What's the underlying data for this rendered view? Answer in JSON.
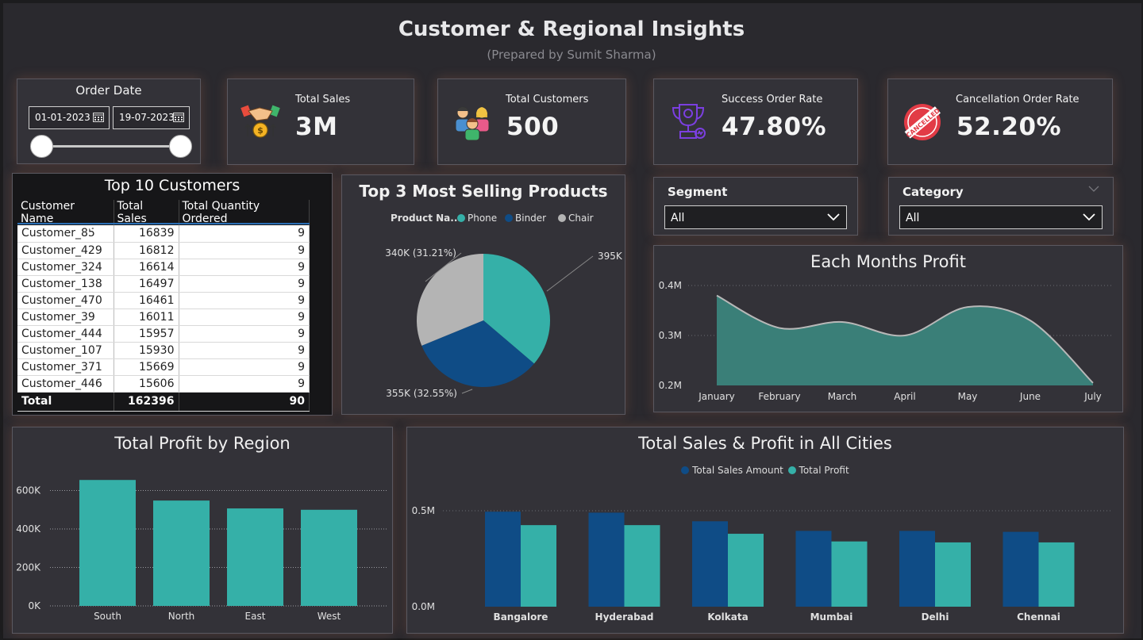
{
  "header": {
    "title": "Customer & Regional Insights",
    "subtitle": "(Prepared by Sumit Sharma)"
  },
  "date_slicer": {
    "title": "Order Date",
    "start": "01-01-2023",
    "end": "19-07-2023"
  },
  "kpis": [
    {
      "label": "Total Sales",
      "value": "3M",
      "icon": "handshake-money-icon"
    },
    {
      "label": "Total Customers",
      "value": "500",
      "icon": "customers-group-icon"
    },
    {
      "label": "Success Order Rate",
      "value": "47.80%",
      "icon": "trophy-icon"
    },
    {
      "label": "Cancellation Order Rate",
      "value": "52.20%",
      "icon": "cancelled-stamp-icon"
    }
  ],
  "top_customers": {
    "title": "Top 10 Customers",
    "columns": [
      "Customer Name",
      "Total Sales",
      "Total Quantity Ordered"
    ],
    "rows": [
      [
        "Customer_85",
        "16839",
        "9"
      ],
      [
        "Customer_429",
        "16812",
        "9"
      ],
      [
        "Customer_324",
        "16614",
        "9"
      ],
      [
        "Customer_138",
        "16497",
        "9"
      ],
      [
        "Customer_470",
        "16461",
        "9"
      ],
      [
        "Customer_39",
        "16011",
        "9"
      ],
      [
        "Customer_444",
        "15957",
        "9"
      ],
      [
        "Customer_107",
        "15930",
        "9"
      ],
      [
        "Customer_371",
        "15669",
        "9"
      ],
      [
        "Customer_446",
        "15606",
        "9"
      ]
    ],
    "total": [
      "Total",
      "162396",
      "90"
    ]
  },
  "slicers": {
    "segment": {
      "title": "Segment",
      "value": "All"
    },
    "category": {
      "title": "Category",
      "value": "All"
    }
  },
  "colors": {
    "teal": "#35b0a8",
    "navy": "#0f4c86",
    "grey": "#b4b4b4",
    "area": "#3a7f78"
  },
  "chart_data": [
    {
      "id": "pie",
      "type": "pie",
      "title": "Top 3 Most Selling Products",
      "legend_title": "Product Na...",
      "categories": [
        "Phone",
        "Binder",
        "Chair"
      ],
      "values": [
        395,
        355,
        340
      ],
      "labels": [
        "395K (36.24%)",
        "355K (32.55%)",
        "340K (31.21%)"
      ]
    },
    {
      "id": "area",
      "type": "area",
      "title": "Each Months Profit",
      "categories": [
        "January",
        "February",
        "March",
        "April",
        "May",
        "June",
        "July"
      ],
      "values": [
        0.38,
        0.315,
        0.327,
        0.3,
        0.357,
        0.33,
        0.205
      ],
      "ylim": [
        0.2,
        0.4
      ],
      "yticks": [
        "0.2M",
        "0.3M",
        "0.4M"
      ]
    },
    {
      "id": "region",
      "type": "bar",
      "title": "Total Profit by Region",
      "categories": [
        "South",
        "North",
        "East",
        "West"
      ],
      "values": [
        655000,
        548000,
        507000,
        500000
      ],
      "ylim": [
        0,
        660000
      ],
      "yticks": [
        "0K",
        "200K",
        "400K",
        "600K"
      ]
    },
    {
      "id": "cities",
      "type": "bar",
      "title": "Total Sales & Profit in All Cities",
      "categories": [
        "Bangalore",
        "Hyderabad",
        "Kolkata",
        "Mumbai",
        "Delhi",
        "Chennai"
      ],
      "series": [
        {
          "name": "Total Sales Amount",
          "values": [
            0.495,
            0.49,
            0.445,
            0.395,
            0.395,
            0.39
          ]
        },
        {
          "name": "Total Profit",
          "values": [
            0.425,
            0.425,
            0.38,
            0.34,
            0.335,
            0.335
          ]
        }
      ],
      "ylim": [
        0,
        0.62
      ],
      "yticks": [
        "0.0M",
        "0.5M"
      ]
    }
  ]
}
